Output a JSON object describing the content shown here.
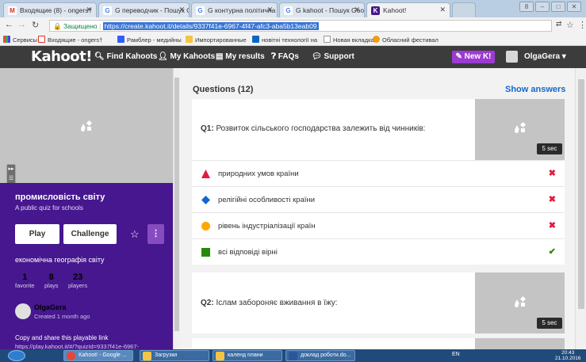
{
  "browser": {
    "tabs": [
      {
        "label": "Входящие (8) - ongers†",
        "icon": "gmail-icon"
      },
      {
        "label": "G переводчик - Пошук G†",
        "icon": "google-icon"
      },
      {
        "label": "G контурна політична кар",
        "icon": "google-icon"
      },
      {
        "label": "G kahoot - Пошук Google",
        "icon": "google-icon"
      },
      {
        "label": "Kahoot!",
        "icon": "kahoot-icon"
      }
    ],
    "url_secure_label": "Защищено",
    "url": "https://create.kahoot.it/details/9337f41e-6967-4f47-afc3-aba5b13eab09",
    "bookmarks": [
      "Сервисы",
      "Входящие - ongers†",
      "Рамблер - медийны",
      "Импортированные",
      "новітні технології на",
      "Новая вкладка",
      "Обласний фестивал"
    ]
  },
  "kahoot_nav": {
    "logo": "Kahoot!",
    "links": [
      "Find Kahoots",
      "My Kahoots",
      "My results",
      "FAQs",
      "Support"
    ],
    "new_button": "New K!",
    "user": "OlgaGera"
  },
  "quiz": {
    "title": "промисловість світу",
    "subtitle": "A public quiz for schools",
    "play_label": "Play",
    "challenge_label": "Challenge",
    "more_label": "⋮",
    "description": "економічна географія світу",
    "stats": [
      {
        "value": "1",
        "label": "favorite"
      },
      {
        "value": "8",
        "label": "plays"
      },
      {
        "value": "23",
        "label": "players"
      }
    ],
    "author": "OlgaGera",
    "created": "Created 1 month ago",
    "share_text": "Copy and share this playable link",
    "share_link": "https://play.kahoot.it/#/?quizId=9337f41e-6967-"
  },
  "questions": {
    "header": "Questions (12)",
    "show_answers": "Show answers",
    "items": [
      {
        "number": "Q1:",
        "text": "Розвиток сільського господарства залежить від чинників:",
        "time": "5 sec",
        "answers": [
          {
            "text": "природних умов країни",
            "shape": "triangle",
            "color": "#e21b3c",
            "correct": false,
            "mark": "✖"
          },
          {
            "text": "релігійні особливості країни",
            "shape": "diamond",
            "color": "#1368ce",
            "correct": false,
            "mark": "✖"
          },
          {
            "text": "рівень індустріалізації країн",
            "shape": "circle",
            "color": "#ffa602",
            "correct": false,
            "mark": "✖"
          },
          {
            "text": "всі відповіді вірні",
            "shape": "square",
            "color": "#26890c",
            "correct": true,
            "mark": "✔"
          }
        ]
      },
      {
        "number": "Q2:",
        "text": "Іслам забороняє вживання в їжу:",
        "time": "5 sec"
      }
    ]
  },
  "taskbar": {
    "items": [
      "Kahoot! - Google ...",
      "Загрузки",
      "календ плани",
      "доклад роботи.do..."
    ],
    "lang": "EN",
    "time": "20:43",
    "date": "21.10.2016"
  }
}
